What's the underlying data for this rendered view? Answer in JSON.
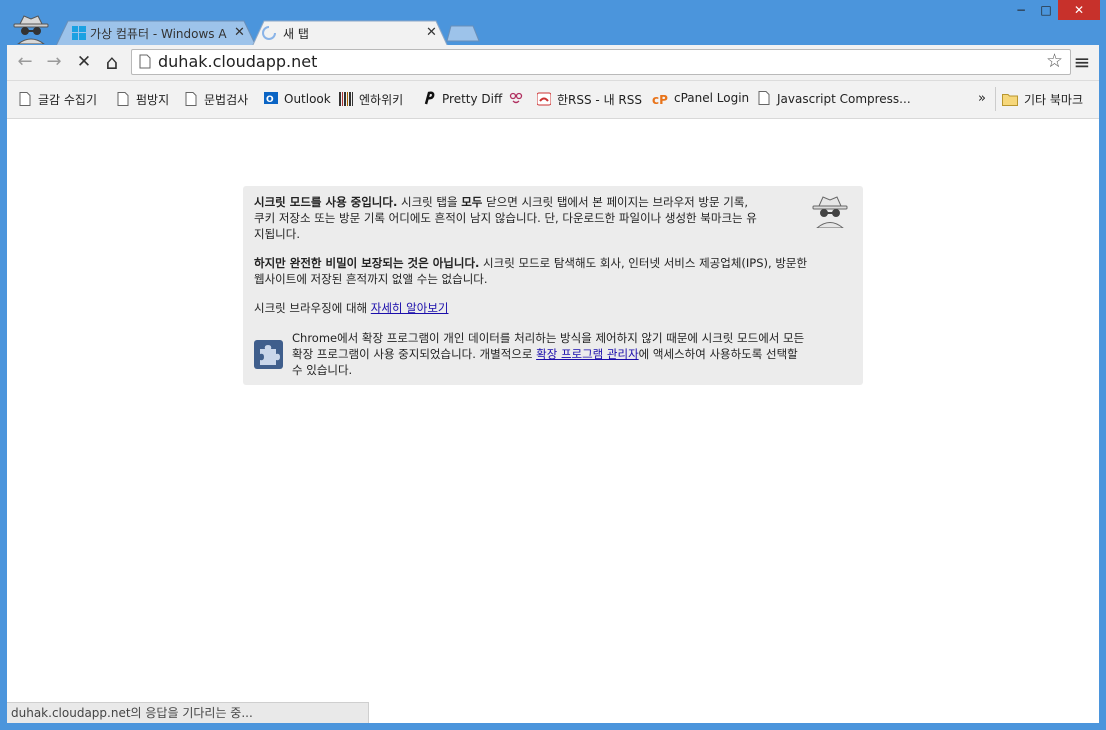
{
  "tabs": [
    {
      "label": "가상 컴퓨터 - Windows A",
      "active": false
    },
    {
      "label": "새 탭",
      "active": true
    }
  ],
  "window_controls": {
    "minimize": "−",
    "maximize": "□",
    "close": "✕"
  },
  "toolbar": {
    "url": "duhak.cloudapp.net",
    "back": "←",
    "forward": "→",
    "stop": "✕",
    "home": "⌂",
    "star": "☆",
    "menu": "≡"
  },
  "bookmarks": [
    {
      "label": "글감 수집기",
      "icon": "page-icon"
    },
    {
      "label": "펌방지",
      "icon": "page-icon"
    },
    {
      "label": "문법검사",
      "icon": "page-icon"
    },
    {
      "label": "Outlook",
      "icon": "outlook-icon"
    },
    {
      "label": "엔하위키",
      "icon": "barcode-icon"
    },
    {
      "label": "Pretty Diff",
      "icon": "pretty-diff-icon"
    },
    {
      "label": "",
      "icon": "face-icon"
    },
    {
      "label": "한RSS - 내 RSS",
      "icon": "rss-icon"
    },
    {
      "label": "cPanel Login",
      "icon": "cpanel-icon"
    },
    {
      "label": "Javascript Compress...",
      "icon": "page-icon"
    }
  ],
  "bookmarks_overflow": "»",
  "other_bookmarks": "기타 북마크",
  "incognito": {
    "p1_bold": "시크릿 모드를 사용 중입니다.",
    "p1_a": " 시크릿 탭을 ",
    "p1_bold2": "모두",
    "p1_b": " 닫으면 시크릿 탭에서 본 페이지는 브라우저 방문 기록,",
    "p1_line2": "쿠키 저장소 또는 방문 기록 어디에도 흔적이 남지 않습니다. 단, 다운로드한 파일이나 생성한 북마크는 유",
    "p1_line3": "지됩니다.",
    "p2_bold": "하지만 완전한 비밀이 보장되는 것은 아닙니다.",
    "p2_a": " 시크릿 모드로 탐색해도 회사, 인터넷 서비스 제공업체(IPS), 방문한",
    "p2_line2": "웹사이트에 저장된 흔적까지 없앨 수는 없습니다.",
    "p3_text": "시크릿 브라우징에 대해 ",
    "p3_link": "자세히 알아보기",
    "p4_line1": "Chrome에서 확장 프로그램이 개인 데이터를 처리하는 방식을 제어하지 않기 때문에 시크릿 모드에서 모든",
    "p4_line2a": "확장 프로그램이 사용 중지되었습니다. 개별적으로 ",
    "p4_link": "확장 프로그램 관리자",
    "p4_line2b": "에 액세스하여 사용하도록 선택할",
    "p4_line3": "수 있습니다."
  },
  "status": "duhak.cloudapp.net의 응답을 기다리는 중..."
}
